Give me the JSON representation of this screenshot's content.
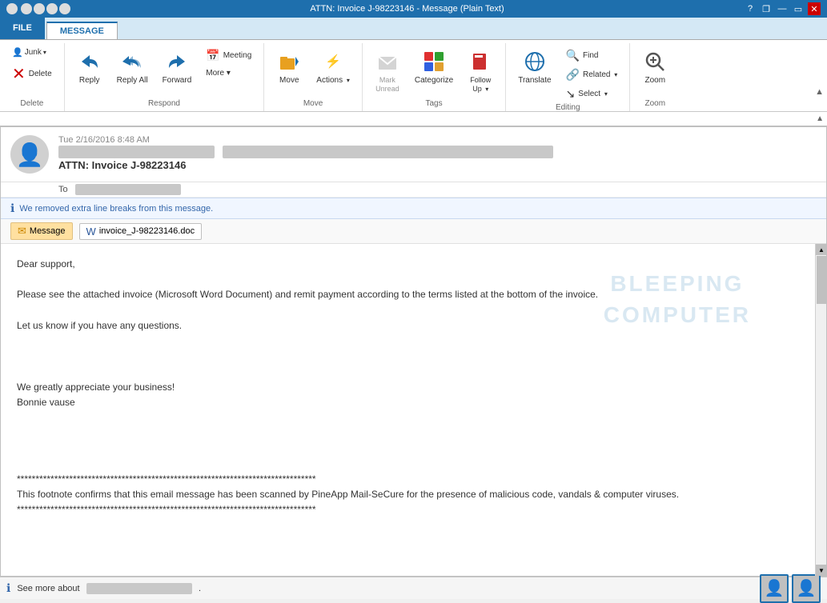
{
  "titlebar": {
    "title": "ATTN: Invoice J-98223146 - Message (Plain Text)",
    "help_btn": "?",
    "restore_btn": "❐",
    "minimize_btn": "—",
    "close_btn": "✕"
  },
  "tabs": [
    {
      "id": "file",
      "label": "FILE"
    },
    {
      "id": "message",
      "label": "MESSAGE",
      "active": true
    }
  ],
  "ribbon": {
    "groups": [
      {
        "id": "delete",
        "label": "Delete",
        "buttons": [
          {
            "id": "junk",
            "label": "Junk ▾",
            "icon": "🚫"
          },
          {
            "id": "delete",
            "label": "Delete",
            "icon": "✕"
          }
        ]
      },
      {
        "id": "respond",
        "label": "Respond",
        "buttons": [
          {
            "id": "reply",
            "label": "Reply",
            "icon": "↩"
          },
          {
            "id": "reply-all",
            "label": "Reply All",
            "icon": "↩↩"
          },
          {
            "id": "forward",
            "label": "Forward",
            "icon": "↪"
          },
          {
            "id": "meeting",
            "label": "Meeting",
            "icon": "📅"
          },
          {
            "id": "more",
            "label": "More ▾",
            "icon": ""
          }
        ]
      },
      {
        "id": "move",
        "label": "Move",
        "buttons": [
          {
            "id": "move",
            "label": "Move",
            "icon": "📁"
          },
          {
            "id": "actions",
            "label": "Actions ▾",
            "icon": "⚡"
          }
        ]
      },
      {
        "id": "tags",
        "label": "Tags",
        "buttons": [
          {
            "id": "mark-unread",
            "label": "Mark\nUnread",
            "icon": "✉"
          },
          {
            "id": "categorize",
            "label": "Categorize",
            "icon": "🏷"
          },
          {
            "id": "follow-up",
            "label": "Follow\nUp ▾",
            "icon": "🚩"
          }
        ]
      },
      {
        "id": "editing",
        "label": "Editing",
        "buttons": [
          {
            "id": "translate",
            "label": "Translate",
            "icon": "🌐"
          },
          {
            "id": "find",
            "label": "Find",
            "icon": "🔍"
          },
          {
            "id": "related",
            "label": "Related ▾",
            "icon": ""
          },
          {
            "id": "select",
            "label": "Select ▾",
            "icon": ""
          }
        ]
      },
      {
        "id": "zoom",
        "label": "Zoom",
        "buttons": [
          {
            "id": "zoom",
            "label": "Zoom",
            "icon": "🔍"
          }
        ]
      }
    ]
  },
  "email": {
    "date": "Tue 2/16/2016 8:48 AM",
    "from_blurred": true,
    "subject": "ATTN: Invoice J-98223146",
    "to_label": "To",
    "to_blurred": true,
    "info_message": "We removed extra line breaks from this message.",
    "attachments": [
      {
        "id": "message-chip",
        "label": "Message",
        "type": "msg"
      },
      {
        "id": "invoice-doc",
        "label": "invoice_J-98223146.doc",
        "type": "doc"
      }
    ],
    "body_lines": [
      "Dear support,",
      "",
      "Please see the attached invoice (Microsoft Word Document) and remit payment according to the terms listed at the bottom of the invoice.",
      "",
      "Let us know if you have any questions.",
      "",
      "",
      "",
      "We greatly appreciate your business!",
      "Bonnie vause",
      "",
      "",
      "",
      "",
      "********************************************************************************",
      "This footnote confirms that this email message has been scanned by PineApp Mail-SeCure for the presence of malicious code, vandals & computer viruses.",
      "********************************************************************************"
    ],
    "watermark_line1": "BLEEPING",
    "watermark_line2": "COMPUTER"
  },
  "statusbar": {
    "info_icon": "ℹ",
    "see_more_text": "See more about",
    "name_blurred": true,
    "people_icon1": "👤",
    "people_icon2": "👤"
  }
}
